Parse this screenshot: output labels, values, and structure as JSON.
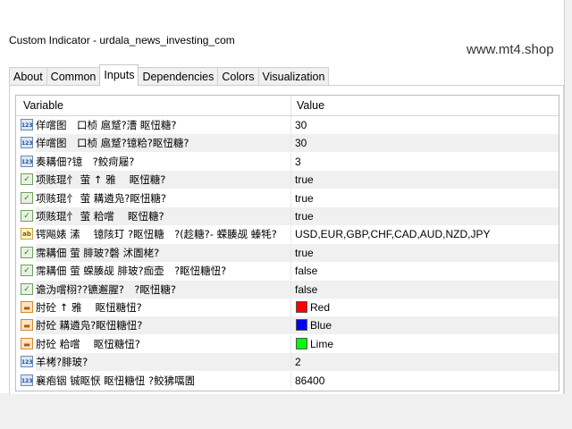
{
  "window": {
    "title": "Custom Indicator - urdala_news_investing_com",
    "watermark": "www.mt4.shop"
  },
  "tabs": [
    {
      "label": "About"
    },
    {
      "label": "Common"
    },
    {
      "label": "Inputs",
      "active": true
    },
    {
      "label": "Dependencies"
    },
    {
      "label": "Colors"
    },
    {
      "label": "Visualization"
    }
  ],
  "table": {
    "col_variable": "Variable",
    "col_value": "Value",
    "rows": [
      {
        "icon": "int-icon",
        "icon_text": "123",
        "name": "佯嚐图　口桢 扈蹵?漕 眍忸糖?",
        "value": "30"
      },
      {
        "icon": "int-icon",
        "icon_text": "123",
        "name": "佯嚐图　口桢 扈蹵?镱粭?眍忸糖?",
        "value": "30"
      },
      {
        "icon": "int-icon",
        "icon_text": "123",
        "name": "奏耩佃?镱　?鲛疴屦?",
        "value": "3"
      },
      {
        "icon": "bool-icon",
        "icon_text": "✓",
        "name": "项赅琨忄 萤 ↑ 雅　 眍忸糖?",
        "value": "true"
      },
      {
        "icon": "bool-icon",
        "icon_text": "✓",
        "name": "项赅琨忄 萤 耩遴凫?眍忸糖?",
        "value": "true"
      },
      {
        "icon": "bool-icon",
        "icon_text": "✓",
        "name": "项赅琨忄 萤 粭嚐　 眍忸糖?",
        "value": "true"
      },
      {
        "icon": "str-icon",
        "icon_text": "ab",
        "name": "锷飚婊 溸　 镱陔玎 ?眍忸糖　?(趁糖?- 蝾腠觇 螓牦?",
        "value": "USD,EUR,GBP,CHF,CAD,AUD,NZD,JPY"
      },
      {
        "icon": "bool-icon",
        "icon_text": "✓",
        "name": "霈耩佃 萤 腓玻?磬 沭圊栳?",
        "value": "true"
      },
      {
        "icon": "bool-icon",
        "icon_text": "✓",
        "name": "霈耩佃 萤 蝾腠觇 腓玻?痂壶　?眍忸糖忸?",
        "value": "false"
      },
      {
        "icon": "bool-icon",
        "icon_text": "✓",
        "name": "谵沩嚐栩??镳邂腥?　?眍忸糖?",
        "value": "false"
      },
      {
        "icon": "color-icon",
        "icon_text": "▬",
        "name": "肘砼 ↑ 雅　 眍忸糖忸?",
        "value": "Red",
        "swatch": "#ff0000"
      },
      {
        "icon": "color-icon",
        "icon_text": "▬",
        "name": "肘砼 耩遴凫?眍忸糖忸?",
        "value": "Blue",
        "swatch": "#0000ff"
      },
      {
        "icon": "color-icon",
        "icon_text": "▬",
        "name": "肘砼 粭嚐　 眍忸糖忸?",
        "value": "Lime",
        "swatch": "#00ff00"
      },
      {
        "icon": "int-icon",
        "icon_text": "123",
        "name": "羊栲?腓玻?",
        "value": "2"
      },
      {
        "icon": "int-icon",
        "icon_text": "123",
        "name": "襄疱铟 铖眍恹 眍忸糖忸 ?鲛狒嚆圊",
        "value": "86400"
      }
    ]
  }
}
